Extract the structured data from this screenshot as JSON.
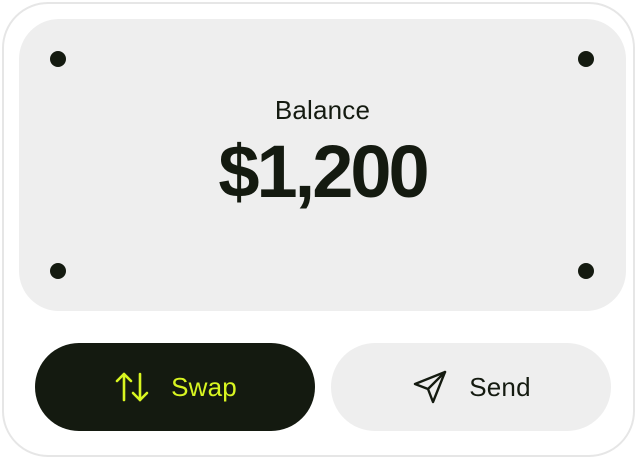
{
  "balance": {
    "label": "Balance",
    "amount": "$1,200"
  },
  "actions": {
    "swap": {
      "label": "Swap",
      "icon": "swap-arrows-icon"
    },
    "send": {
      "label": "Send",
      "icon": "send-paper-plane-icon"
    }
  },
  "colors": {
    "accent": "#d8f521",
    "dark": "#141a10",
    "panel": "#eeeeee",
    "card": "#ffffff"
  }
}
